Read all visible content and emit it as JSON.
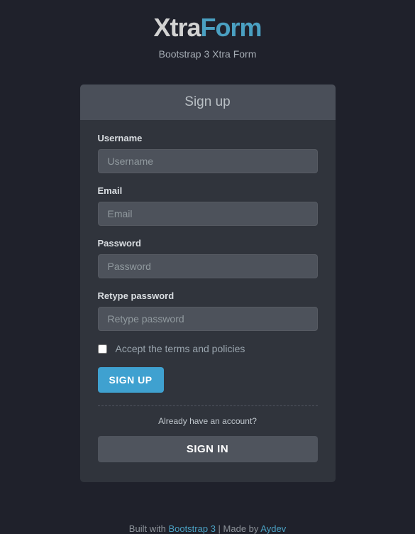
{
  "header": {
    "logo_part1": "Xtra",
    "logo_part2": "Form",
    "tagline": "Bootstrap 3 Xtra Form"
  },
  "panel": {
    "title": "Sign up"
  },
  "form": {
    "username_label": "Username",
    "username_placeholder": "Username",
    "email_label": "Email",
    "email_placeholder": "Email",
    "password_label": "Password",
    "password_placeholder": "Password",
    "retype_label": "Retype password",
    "retype_placeholder": "Retype password",
    "terms_label": "Accept the terms and policies",
    "signup_button": "SIGN UP",
    "already_text": "Already have an account?",
    "signin_button": "SIGN IN"
  },
  "footer": {
    "prefix": "Built with ",
    "link1": "Bootstrap 3",
    "separator": " | Made by ",
    "link2": "Aydev"
  }
}
